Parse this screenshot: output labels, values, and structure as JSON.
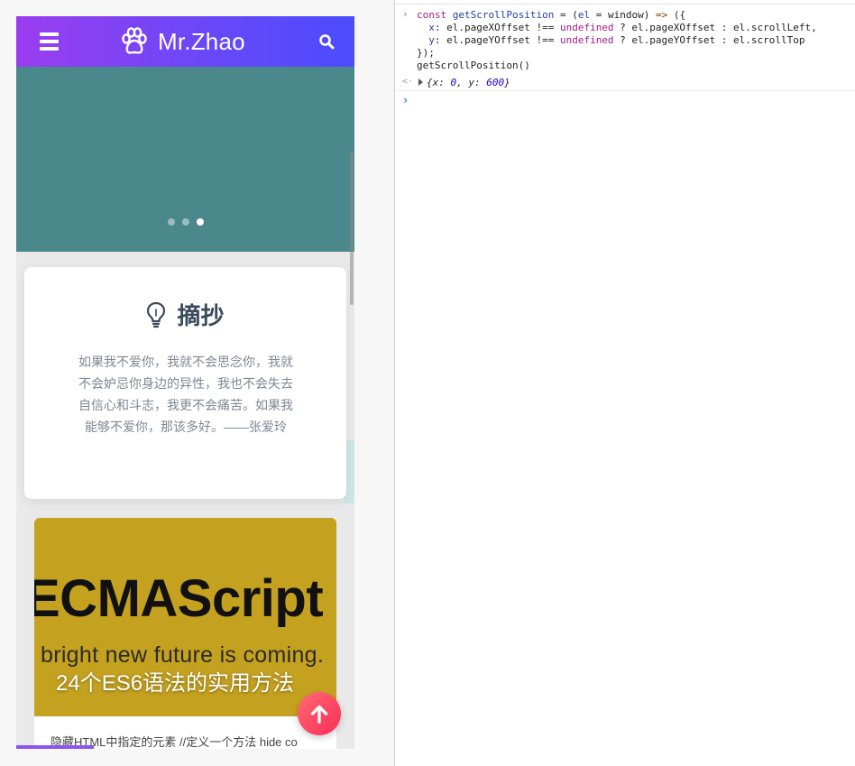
{
  "site": {
    "brand_name": "Mr.Zhao",
    "icons": {
      "menu": "menu-icon",
      "paw": "paw-icon",
      "search": "search-icon"
    },
    "colors": {
      "header_start": "#9b3df0",
      "header_end": "#4b4cff",
      "banner": "#4a888c",
      "fab": "#fb2d58"
    },
    "banner": {
      "slide_count": 3,
      "active_slide": 3
    },
    "quote_card": {
      "title": "摘抄",
      "icon": "lightbulb-icon",
      "text": "如果我不爱你，我就不会思念你，我就不会妒忌你身边的异性，我也不会失去自信心和斗志，我更不会痛苦。如果我能够不爱你，那该多好。——张爱玲"
    },
    "post": {
      "cover_heading": "ECMAScript",
      "cover_tagline": "bright new future is coming.",
      "title": "24个ES6语法的实用方法",
      "excerpt": "隐藏HTML中指定的元素 //定义一个方法 hide co"
    },
    "scroll_to_top_icon": "arrow-up-icon"
  },
  "console": {
    "code_lines": [
      "const getScrollPosition = (el = window) => ({",
      "  x: el.pageXOffset !== undefined ? el.pageXOffset : el.scrollLeft,",
      "  y: el.pageYOffset !== undefined ? el.pageYOffset : el.scrollTop",
      "});",
      "getScrollPosition()"
    ],
    "result": {
      "x": "0",
      "y": "600"
    }
  }
}
